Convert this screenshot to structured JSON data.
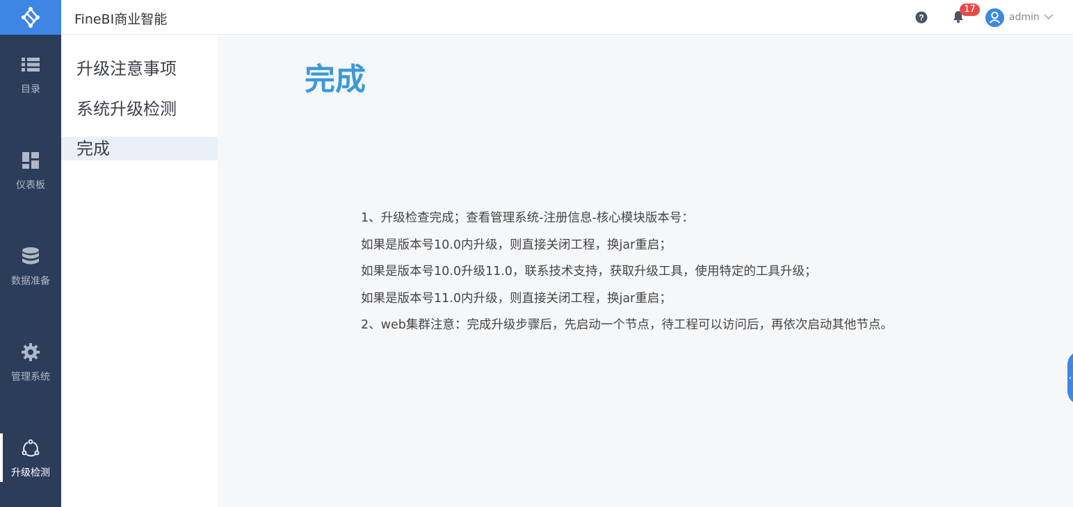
{
  "app": {
    "title": "FineBI商业智能"
  },
  "rail": {
    "items": [
      {
        "label": "目录",
        "icon": "list-icon"
      },
      {
        "label": "仪表板",
        "icon": "dashboard-icon"
      },
      {
        "label": "数据准备",
        "icon": "database-icon"
      },
      {
        "label": "管理系统",
        "icon": "gear-icon"
      },
      {
        "label": "升级检测",
        "icon": "upgrade-cycle-icon",
        "active": true
      }
    ]
  },
  "header": {
    "notification_count": "17",
    "user_name": "admin"
  },
  "steps": {
    "items": [
      {
        "label": "升级注意事项"
      },
      {
        "label": "系统升级检测"
      },
      {
        "label": "完成",
        "active": true
      }
    ]
  },
  "main": {
    "title": "完成",
    "notes": [
      "1、升级检查完成；查看管理系统-注册信息-核心模块版本号：",
      "如果是版本号10.0内升级，则直接关闭工程，换jar重启；",
      "如果是版本号10.0升级11.0，联系技术支持，获取升级工具，使用特定的工具升级；",
      "如果是版本号11.0内升级，则直接关闭工程，换jar重启；",
      "2、web集群注意：完成升级步骤后，先启动一个节点，待工程可以访问后，再依次启动其他节点。"
    ]
  },
  "colors": {
    "rail_bg": "#2c3d5a",
    "logo_bg": "#3d86e4",
    "title_blue": "#3a9ad9",
    "badge_red": "#e64b4b"
  }
}
